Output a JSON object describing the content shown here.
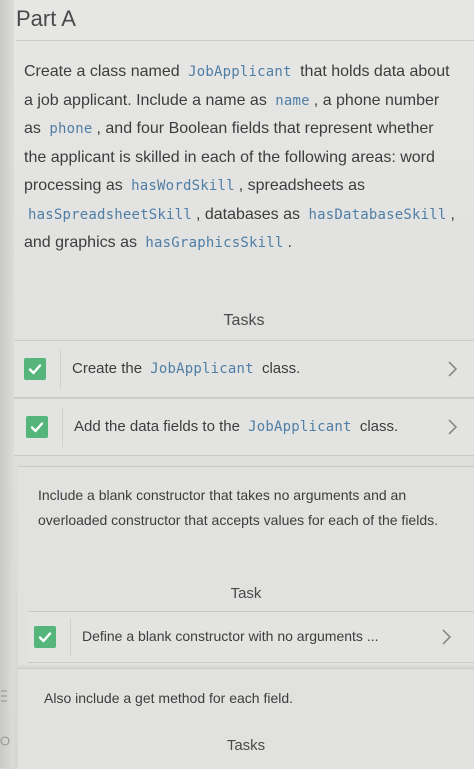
{
  "part": {
    "title": "Part A"
  },
  "intro": {
    "t1": "Create a class named",
    "class_name": "JobApplicant",
    "t2": "that holds data about a job applicant. Include a name as",
    "name_field": "name",
    "t3": ", a phone number as",
    "phone_field": "phone",
    "t4": ", and four Boolean fields that represent whether the applicant is skilled in each of the following areas: word processing as",
    "word_field": "hasWordSkill",
    "t5": ", spreadsheets as",
    "spreadsheet_field": "hasSpreadsheetSkill",
    "t6": ", databases as",
    "database_field": "hasDatabaseSkill",
    "t7": ", and graphics as",
    "graphics_field": "hasGraphicsSkill",
    "t8": "."
  },
  "tasks_section": {
    "header": "Tasks",
    "items": [
      {
        "prefix": "Create the",
        "code": "JobApplicant",
        "suffix": "class.",
        "completed": true
      },
      {
        "prefix": "Add the data fields to the",
        "code": "JobApplicant",
        "suffix": "class.",
        "completed": true
      }
    ]
  },
  "constructor_section": {
    "text": "Include a blank constructor that takes no arguments and an overloaded constructor that accepts values for each of the fields.",
    "header": "Task",
    "items": [
      {
        "label": "Define a blank constructor with no arguments ...",
        "completed": true
      }
    ]
  },
  "get_section": {
    "text": "Also include a get method for each field.",
    "header": "Tasks"
  },
  "colors": {
    "check_green": "#55b57a",
    "code_blue": "#4f7ea6"
  }
}
